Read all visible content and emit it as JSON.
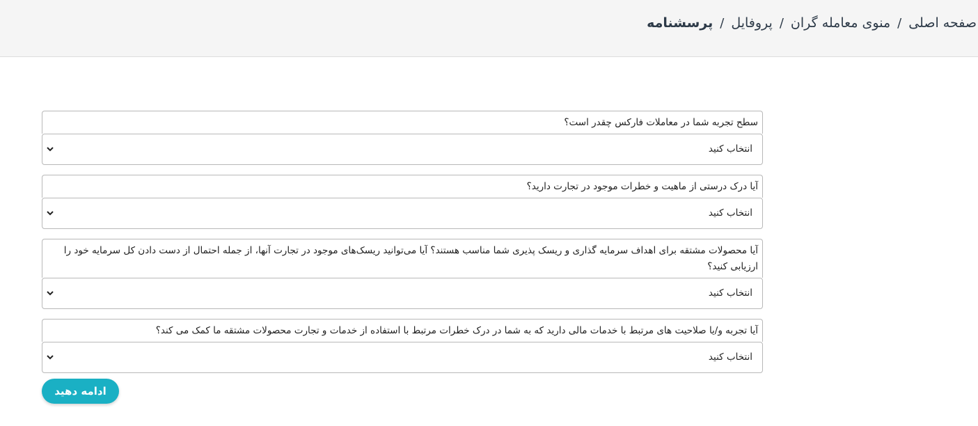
{
  "breadcrumb": {
    "items": [
      "صفحه اصلی",
      "منوی معامله گران",
      "پروفایل"
    ],
    "current": "پرسشنامه",
    "separator": "/"
  },
  "questions": [
    {
      "label": "سطح تجربه شما در معاملات فارکس چقدر است؟",
      "selected": "انتخاب کنید"
    },
    {
      "label": "آیا درک درستی از ماهیت و خطرات موجود در تجارت دارید؟",
      "selected": "انتخاب کنید"
    },
    {
      "label": "آیا محصولات مشتقه برای اهداف سرمایه گذاری و ریسک پذیری شما مناسب هستند؟ آیا می‌توانید ریسک‌های موجود در تجارت آنها، از جمله احتمال از دست دادن کل سرمایه خود را ارزیابی کنید؟",
      "selected": "انتخاب کنید"
    },
    {
      "label": "آیا تجربه و/یا صلاحیت های مرتبط با خدمات مالی دارید که به شما در درک خطرات مرتبط با استفاده از خدمات و تجارت محصولات مشتقه ما کمک می کند؟",
      "selected": "انتخاب کنید"
    }
  ],
  "continue_button": "ادامه دهید",
  "colors": {
    "accent": "#1ab0c4",
    "topbar": "#f5f5f5",
    "border": "#b8b8b8"
  },
  "icons": {
    "select_arrow": "chevron-down-icon"
  }
}
